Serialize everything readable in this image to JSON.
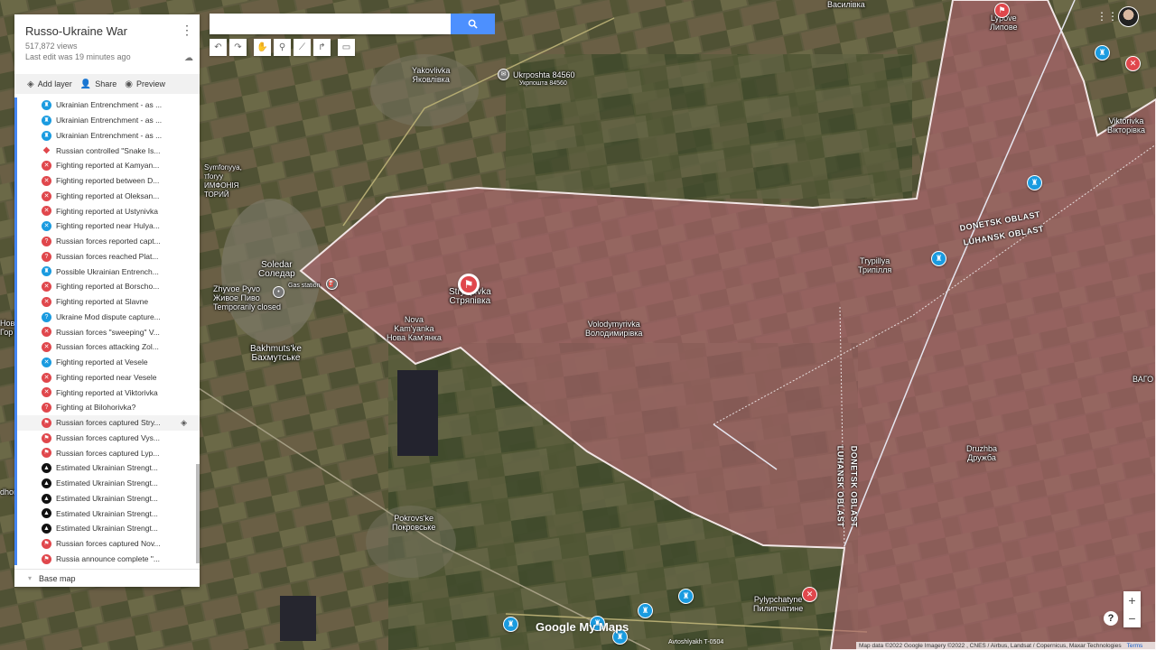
{
  "panel": {
    "title": "Russo-Ukraine War",
    "views": "517,872 views",
    "last_edit": "Last edit was 19 minutes ago",
    "actions": {
      "add_layer": "Add layer",
      "share": "Share",
      "preview": "Preview"
    },
    "base_map": "Base map",
    "items": [
      {
        "label": "Ukrainian Entrenchment - as ...",
        "icon": "fortress",
        "color": "#1a9be0"
      },
      {
        "label": "Ukrainian Entrenchment - as ...",
        "icon": "fortress",
        "color": "#1a9be0"
      },
      {
        "label": "Ukrainian Entrenchment - as ...",
        "icon": "fortress",
        "color": "#1a9be0"
      },
      {
        "label": "Russian controlled \"Snake Is...",
        "icon": "polygon",
        "color": "#e0474c"
      },
      {
        "label": "Fighting reported at Kamyan...",
        "icon": "crossed-swords",
        "color": "#e0474c"
      },
      {
        "label": "Fighting reported between D...",
        "icon": "crossed-swords",
        "color": "#e0474c"
      },
      {
        "label": "Fighting reported at Oleksan...",
        "icon": "crossed-swords",
        "color": "#e0474c"
      },
      {
        "label": "Fighting reported at Ustynivka",
        "icon": "crossed-swords",
        "color": "#e0474c"
      },
      {
        "label": "Fighting reported near Hulya...",
        "icon": "crossed-swords",
        "color": "#1a9be0"
      },
      {
        "label": "Russian forces reported capt...",
        "icon": "question",
        "color": "#e0474c"
      },
      {
        "label": "Russian forces reached Plat...",
        "icon": "question",
        "color": "#e0474c"
      },
      {
        "label": "Possible Ukrainian Entrench...",
        "icon": "fortress",
        "color": "#1a9be0"
      },
      {
        "label": "Fighting reported at Borscho...",
        "icon": "crossed-swords",
        "color": "#e0474c"
      },
      {
        "label": "Fighting reported at Slavne",
        "icon": "crossed-swords",
        "color": "#e0474c"
      },
      {
        "label": "Ukraine Mod dispute capture...",
        "icon": "question",
        "color": "#1a9be0"
      },
      {
        "label": "Russian forces \"sweeping\" V...",
        "icon": "crossed-swords",
        "color": "#e0474c"
      },
      {
        "label": "Russian forces attacking Zol...",
        "icon": "crossed-swords",
        "color": "#e0474c"
      },
      {
        "label": "Fighting reported at Vesele",
        "icon": "crossed-swords",
        "color": "#1a9be0"
      },
      {
        "label": "Fighting reported near Vesele",
        "icon": "crossed-swords",
        "color": "#e0474c"
      },
      {
        "label": "Fighting reported at Viktorivka",
        "icon": "crossed-swords",
        "color": "#e0474c"
      },
      {
        "label": "Fighting at Bilohorivka?",
        "icon": "question",
        "color": "#e0474c"
      },
      {
        "label": "Russian forces captured Stry...",
        "icon": "flag",
        "color": "#e0474c"
      },
      {
        "label": "Russian forces captured Vys...",
        "icon": "flag",
        "color": "#e0474c"
      },
      {
        "label": "Russian forces captured Lyp...",
        "icon": "flag",
        "color": "#e0474c"
      },
      {
        "label": "Estimated Ukrainian Strengt...",
        "icon": "triangle",
        "color": "#111111"
      },
      {
        "label": "Estimated Ukrainian Strengt...",
        "icon": "triangle",
        "color": "#111111"
      },
      {
        "label": "Estimated Ukrainian Strengt...",
        "icon": "triangle",
        "color": "#111111"
      },
      {
        "label": "Estimated Ukrainian Strengt...",
        "icon": "triangle",
        "color": "#111111"
      },
      {
        "label": "Estimated Ukrainian Strengt...",
        "icon": "triangle",
        "color": "#111111"
      },
      {
        "label": "Russian forces captured Nov...",
        "icon": "flag",
        "color": "#e0474c"
      },
      {
        "label": "Russia announce complete \"...",
        "icon": "flag",
        "color": "#e0474c"
      }
    ]
  },
  "map": {
    "place_labels": [
      {
        "text": "Yakovlivka\nЯковлівка"
      },
      {
        "text": "Ukrposhta 84560"
      },
      {
        "text": "Укрпошта 84560"
      },
      {
        "text": "Symfonyya,\nтforyy\nИМФОНІЯ\nТОРИЙ"
      },
      {
        "text": "Soledar\nСоледар"
      },
      {
        "text": "Zhyvoe Pyvo\nЖивое Пиво\nTemporarily closed"
      },
      {
        "text": "Gas station"
      },
      {
        "text": "Bakhmuts'ke\nБахмутське"
      },
      {
        "text": "Stryapivka\nСтряпівка"
      },
      {
        "text": "Nova\nKam'yanka\nНова Кам'янка"
      },
      {
        "text": "Volodymyrivka\nВолодимирівка"
      },
      {
        "text": "Trypillya\nТрипілля"
      },
      {
        "text": "Druzhba\nДружба"
      },
      {
        "text": "Pokrovs'ke\nПокровське"
      },
      {
        "text": "Pylypchatyne\nПилипчатине"
      },
      {
        "text": "Lypove\nЛипове"
      },
      {
        "text": "Viktorivka\nВікторівка"
      },
      {
        "text": "Василівка"
      },
      {
        "text": "ВАГО"
      },
      {
        "text": "Нова\nГор"
      },
      {
        "text": "dhor"
      }
    ],
    "oblast_labels": [
      "DONETSK OBLAST",
      "LUHANSK OBLAST",
      "LUHANSK OBLAST",
      "DONETSK OBLAST"
    ],
    "road_label": "T-0504",
    "road_label_2": "Avtoshlyakh T-0504",
    "logo": "Google My Maps",
    "footer": "Map data ©2022 Google Imagery ©2022 , CNES / Airbus, Landsat / Copernicus, Maxar Technologies",
    "terms": "Terms",
    "colors": {
      "occupied_fill": "#b06470",
      "border": "#f2e6e6",
      "accent": "#4d90fe"
    }
  }
}
